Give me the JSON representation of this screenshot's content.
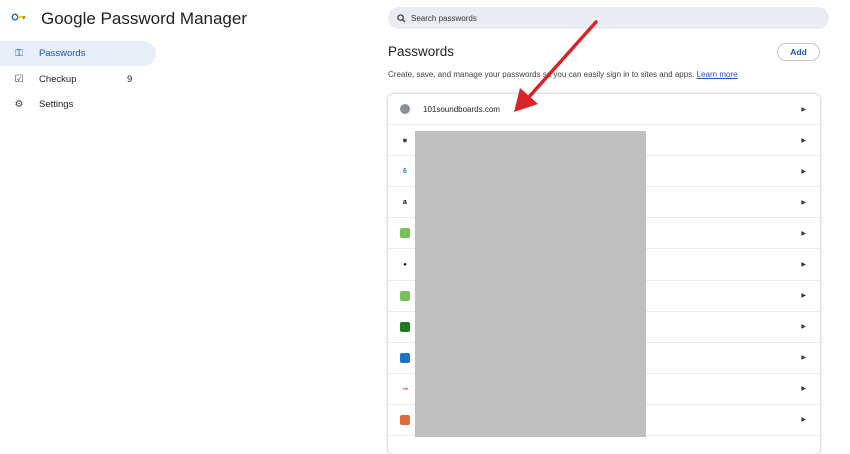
{
  "app": {
    "title": "Google Password Manager"
  },
  "sidebar": {
    "items": [
      {
        "label": "Passwords",
        "icon": "key-icon",
        "active": true
      },
      {
        "label": "Checkup",
        "icon": "checkup-icon",
        "count": "9"
      },
      {
        "label": "Settings",
        "icon": "gear-icon"
      }
    ]
  },
  "search": {
    "placeholder": "Search passwords"
  },
  "main": {
    "heading": "Passwords",
    "add_label": "Add",
    "description": "Create, save, and manage your passwords so you can easily sign in to sites and apps.",
    "learn_more": "Learn more"
  },
  "rows": [
    {
      "name": "101soundboards.com",
      "icon": "101soundboards-icon",
      "color": "#8a8fa0"
    },
    {
      "name": "",
      "icon": "globe-icon",
      "color": "#444444"
    },
    {
      "name": "",
      "icon": "lock-app-icon",
      "color": "#1a8f9a"
    },
    {
      "name": "",
      "icon": "amazon-icon",
      "color": "#111111"
    },
    {
      "name": "",
      "icon": "android-icon",
      "color": "#78c257"
    },
    {
      "name": "",
      "icon": "apple-icon",
      "color": "#111111"
    },
    {
      "name": "",
      "icon": "android-icon",
      "color": "#78c257"
    },
    {
      "name": "",
      "icon": "green-app-icon",
      "color": "#1d7a1d"
    },
    {
      "name": "",
      "icon": "blue-square-icon",
      "color": "#1a73c8"
    },
    {
      "name": "",
      "icon": "orange-link-icon",
      "color": "#e0603a"
    },
    {
      "name": "",
      "icon": "app-icon",
      "color": "#e06a3a"
    }
  ],
  "annotation": {
    "color": "#d9232a"
  }
}
